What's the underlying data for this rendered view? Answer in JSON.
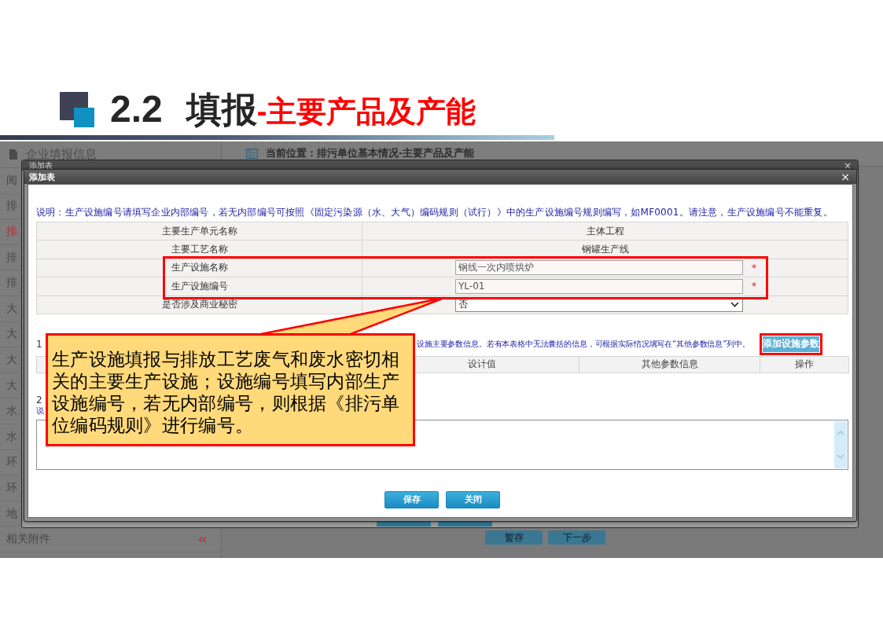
{
  "slide_title": {
    "number": "2.2",
    "heading": "填报",
    "subheading": "-主要产品及产能"
  },
  "background_app": {
    "sidebar": {
      "title": "企业填报信息",
      "items": [
        {
          "label": "阅",
          "selected": false
        },
        {
          "label": "排",
          "selected": false
        },
        {
          "label": "排",
          "selected": true
        },
        {
          "label": "排",
          "selected": false
        },
        {
          "label": "排",
          "selected": false
        },
        {
          "label": "大",
          "selected": false
        },
        {
          "label": "大",
          "selected": false
        },
        {
          "label": "大",
          "selected": false
        },
        {
          "label": "大",
          "selected": false
        },
        {
          "label": "水",
          "selected": false
        },
        {
          "label": "水",
          "selected": false
        },
        {
          "label": "环",
          "selected": false
        },
        {
          "label": "环",
          "selected": false
        },
        {
          "label": "地",
          "selected": false
        },
        {
          "label": "相关附件",
          "selected": false
        }
      ]
    },
    "breadcrumb": "当前位置：排污单位基本情况-主要产品及产能",
    "buttons": [
      "暂存",
      "下一步"
    ]
  },
  "back_dialog": {
    "title": "添加表",
    "close": "×"
  },
  "dialog": {
    "title": "添加表",
    "close": "×",
    "note": "说明：生产设施编号请填写企业内部编号，若无内部编号可按照《固定污染源（水、大气）编码规则（试行）》中的生产设施编号规则编写，如MF0001。请注意，生产设施编号不能重复。",
    "form_rows": [
      {
        "label": "主要生产单元名称",
        "kind": "text",
        "value": "主体工程",
        "highlighted": false
      },
      {
        "label": "主要工艺名称",
        "kind": "text",
        "value": "钢罐生产线",
        "highlighted": false
      },
      {
        "label": "生产设施名称",
        "kind": "input",
        "value": "钢线一次内喷烘炉",
        "required_mark": "*",
        "highlighted": true
      },
      {
        "label": "生产设施编号",
        "kind": "input",
        "value": "YL-01",
        "required_mark": "*",
        "highlighted": true
      },
      {
        "label": "是否涉及商业秘密",
        "kind": "select",
        "value": "否",
        "highlighted": false
      }
    ],
    "section_1": {
      "number": "1",
      "hint": "设施主要参数信息。若有本表格中无法囊括的信息，可根据实际情况填写在“其他参数信息”列中。",
      "add_button": {
        "label": "添加设施参数",
        "highlighted": true
      },
      "columns": [
        "设计值",
        "其他参数信息",
        "操作"
      ]
    },
    "section_2": {
      "number": "2",
      "hint": "说"
    },
    "buttons": [
      "保存",
      "关闭"
    ]
  },
  "callout": {
    "text": "生产设施填报与排放工艺废气和废水密切相关的主要生产设施；设施编号填写内部生产设施编号，若无内部编号，则根据《排污单位编码规则》进行编号。"
  }
}
